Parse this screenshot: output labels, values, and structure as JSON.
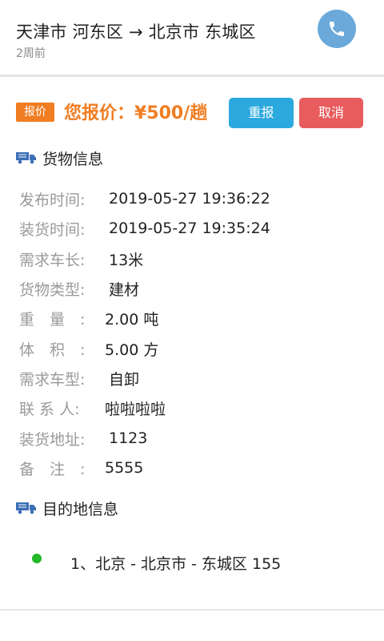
{
  "header": {
    "route": "天津市 河东区 → 北京市 东城区",
    "time_ago": "2周前",
    "phone_icon": "phone-icon"
  },
  "quote": {
    "tag": "报价",
    "price_text": "您报价：¥500/趟",
    "requote_label": "重报",
    "cancel_label": "取消"
  },
  "cargo": {
    "title": "货物信息",
    "rows": [
      {
        "label": "发布时间:",
        "value": "2019-05-27 19:36:22"
      },
      {
        "label": "装货时间:",
        "value": "2019-05-27 19:35:24"
      },
      {
        "label": "需求车长:",
        "value": "13米"
      },
      {
        "label": "货物类型:",
        "value": "建材"
      },
      {
        "label": "重　量　:",
        "value": "2.00 吨"
      },
      {
        "label": "体　积　:",
        "value": "5.00 方"
      },
      {
        "label": "需求车型:",
        "value": "自卸"
      },
      {
        "label": "联 系 人:",
        "value": "啦啦啦啦"
      },
      {
        "label": "装货地址:",
        "value": "1123"
      },
      {
        "label": "备　注　:",
        "value": "5555"
      }
    ]
  },
  "destination": {
    "title": "目的地信息",
    "items": [
      {
        "text": "1、北京 - 北京市 - 东城区 155"
      }
    ]
  },
  "colors": {
    "accent_orange": "#f07d22",
    "requote_blue": "#2ba9de",
    "cancel_red": "#e85c5e",
    "phone_blue": "#6aa9da",
    "dot_green": "#22b828"
  }
}
